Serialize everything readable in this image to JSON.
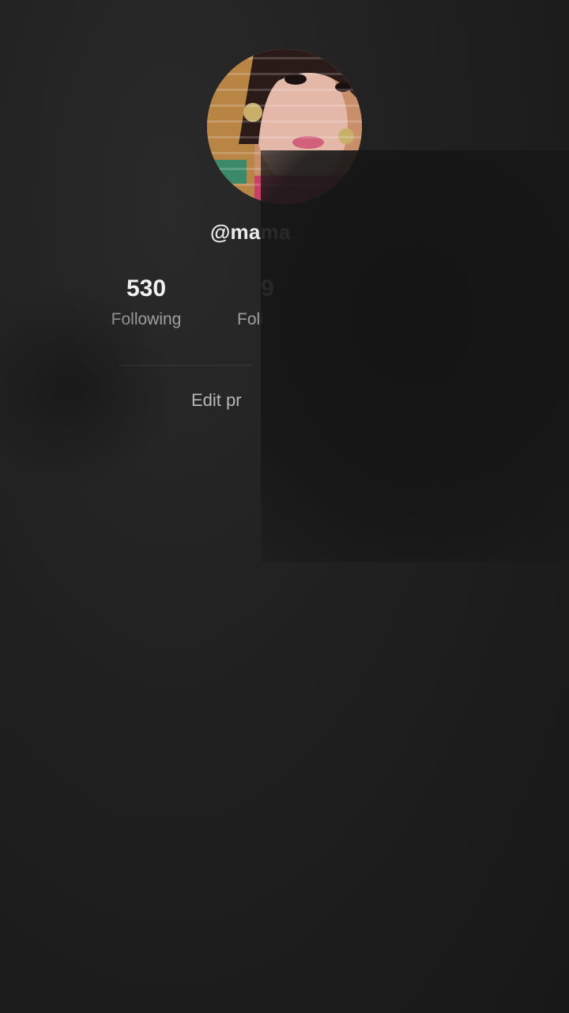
{
  "profile": {
    "username": "@mama",
    "avatar_icon": "profile-photo"
  },
  "stats": {
    "following": {
      "value": "530",
      "label": "Following"
    },
    "followers": {
      "value": "9",
      "label": "Foll"
    }
  },
  "actions": {
    "edit_label": "Edit pr"
  },
  "colors": {
    "background": "#1c1c1c",
    "primary_text": "#f2f2f2",
    "secondary_text": "#a0a0a0"
  }
}
